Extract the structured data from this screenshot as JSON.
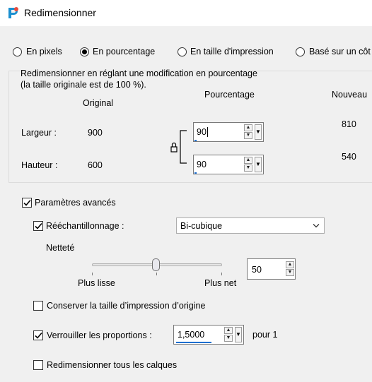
{
  "window": {
    "title": "Redimensionner"
  },
  "modes": [
    {
      "label": "En pixels",
      "selected": false
    },
    {
      "label": "En pourcentage",
      "selected": true
    },
    {
      "label": "En taille d'impression",
      "selected": false
    },
    {
      "label": "Basé sur un côt",
      "selected": false
    }
  ],
  "group": {
    "description_line1": "Redimensionner en réglant une modification en pourcentage",
    "description_line2": "(la taille originale est de 100 %).",
    "col_original": "Original",
    "col_percent": "Pourcentage",
    "col_new": "Nouveau",
    "width": {
      "label": "Largeur :",
      "original": "900",
      "percent": "90",
      "new": "810"
    },
    "height": {
      "label": "Hauteur :",
      "original": "600",
      "percent": "90",
      "new": "540"
    }
  },
  "advanced": {
    "label": "Paramètres avancés",
    "checked": true,
    "resampling": {
      "label": "Rééchantillonnage :",
      "checked": true,
      "value": "Bi-cubique"
    },
    "sharpness": {
      "label": "Netteté",
      "min_label": "Plus lisse",
      "max_label": "Plus net",
      "value": "50",
      "level": 0.5
    },
    "keep_print_size": {
      "label": "Conserver la taille d’impression d’origine",
      "checked": false
    },
    "lock_ratio": {
      "label": "Verrouiller les proportions :",
      "checked": true,
      "value": "1,5000",
      "suffix": "pour 1"
    },
    "all_layers": {
      "label": "Redimensionner tous les calques",
      "checked": false
    }
  },
  "icons": {
    "app": "paintshop-icon",
    "lock": "lock-icon",
    "check": "checkmark-icon",
    "chevron": "chevron-down-icon"
  }
}
